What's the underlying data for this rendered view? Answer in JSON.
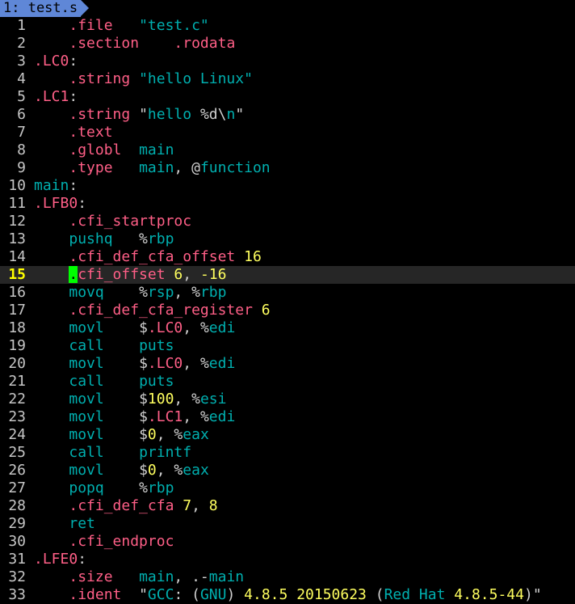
{
  "tab": {
    "label": "1: test.s",
    "background": "#5f87d7"
  },
  "cursor": {
    "line": 15,
    "highlight_color": "#00ff00"
  },
  "colors": {
    "directive": "#ff5f87",
    "instruction": "#00afaf",
    "label": "#00afaf",
    "number": "#ffff5f",
    "string": "#00afaf",
    "default": "#d0d0d0"
  },
  "lines": [
    {
      "n": "1",
      "tokens": [
        {
          "t": "    ",
          "c": "#d0d0d0"
        },
        {
          "t": ".file",
          "c": "#ff5f87"
        },
        {
          "t": "   ",
          "c": "#d0d0d0"
        },
        {
          "t": "\"test.c\"",
          "c": "#00afaf",
          "q": true
        }
      ]
    },
    {
      "n": "2",
      "tokens": [
        {
          "t": "    ",
          "c": "#d0d0d0"
        },
        {
          "t": ".section",
          "c": "#ff5f87"
        },
        {
          "t": "    ",
          "c": "#d0d0d0"
        },
        {
          "t": ".rodata",
          "c": "#ff5f87"
        }
      ]
    },
    {
      "n": "3",
      "tokens": [
        {
          "t": ".LC0",
          "c": "#ff5f87"
        },
        {
          "t": ":",
          "c": "#d0d0d0"
        }
      ]
    },
    {
      "n": "4",
      "tokens": [
        {
          "t": "    ",
          "c": "#d0d0d0"
        },
        {
          "t": ".string",
          "c": "#ff5f87"
        },
        {
          "t": " ",
          "c": "#d0d0d0"
        },
        {
          "t": "\"hello Linux\"",
          "c": "#00afaf",
          "q": true
        }
      ]
    },
    {
      "n": "5",
      "tokens": [
        {
          "t": ".LC1",
          "c": "#ff5f87"
        },
        {
          "t": ":",
          "c": "#d0d0d0"
        }
      ]
    },
    {
      "n": "6",
      "tokens": [
        {
          "t": "    ",
          "c": "#d0d0d0"
        },
        {
          "t": ".string",
          "c": "#ff5f87"
        },
        {
          "t": " ",
          "c": "#d0d0d0"
        },
        {
          "t": "\"",
          "c": "#d0d0d0"
        },
        {
          "t": "hello ",
          "c": "#00afaf"
        },
        {
          "t": "%d",
          "c": "#d0d0d0"
        },
        {
          "t": "\\",
          "c": "#d0d0d0"
        },
        {
          "t": "n",
          "c": "#00afaf"
        },
        {
          "t": "\"",
          "c": "#d0d0d0"
        }
      ]
    },
    {
      "n": "7",
      "tokens": [
        {
          "t": "    ",
          "c": "#d0d0d0"
        },
        {
          "t": ".text",
          "c": "#ff5f87"
        }
      ]
    },
    {
      "n": "8",
      "tokens": [
        {
          "t": "    ",
          "c": "#d0d0d0"
        },
        {
          "t": ".globl",
          "c": "#ff5f87"
        },
        {
          "t": "  ",
          "c": "#d0d0d0"
        },
        {
          "t": "main",
          "c": "#00afaf"
        }
      ]
    },
    {
      "n": "9",
      "tokens": [
        {
          "t": "    ",
          "c": "#d0d0d0"
        },
        {
          "t": ".type",
          "c": "#ff5f87"
        },
        {
          "t": "   ",
          "c": "#d0d0d0"
        },
        {
          "t": "main",
          "c": "#00afaf"
        },
        {
          "t": ", @",
          "c": "#d0d0d0"
        },
        {
          "t": "function",
          "c": "#00afaf"
        }
      ]
    },
    {
      "n": "10",
      "tokens": [
        {
          "t": "main",
          "c": "#00afaf"
        },
        {
          "t": ":",
          "c": "#d0d0d0"
        }
      ]
    },
    {
      "n": "11",
      "tokens": [
        {
          "t": ".LFB0",
          "c": "#ff5f87"
        },
        {
          "t": ":",
          "c": "#d0d0d0"
        }
      ]
    },
    {
      "n": "12",
      "tokens": [
        {
          "t": "    ",
          "c": "#d0d0d0"
        },
        {
          "t": ".cfi_startproc",
          "c": "#ff5f87"
        }
      ]
    },
    {
      "n": "13",
      "tokens": [
        {
          "t": "    ",
          "c": "#d0d0d0"
        },
        {
          "t": "pushq",
          "c": "#00afaf"
        },
        {
          "t": "   %",
          "c": "#d0d0d0"
        },
        {
          "t": "rbp",
          "c": "#00afaf"
        }
      ]
    },
    {
      "n": "14",
      "tokens": [
        {
          "t": "    ",
          "c": "#d0d0d0"
        },
        {
          "t": ".cfi_def_cfa_offset",
          "c": "#ff5f87"
        },
        {
          "t": " ",
          "c": "#d0d0d0"
        },
        {
          "t": "16",
          "c": "#ffff5f"
        }
      ]
    },
    {
      "n": "15",
      "tokens": [
        {
          "t": "    ",
          "c": "#d0d0d0"
        },
        {
          "t": ".",
          "c": "#000000",
          "cursor": true
        },
        {
          "t": "cfi_offset",
          "c": "#ff5f87"
        },
        {
          "t": " ",
          "c": "#d0d0d0"
        },
        {
          "t": "6",
          "c": "#ffff5f"
        },
        {
          "t": ", ",
          "c": "#d0d0d0"
        },
        {
          "t": "-16",
          "c": "#ffff5f"
        }
      ]
    },
    {
      "n": "16",
      "tokens": [
        {
          "t": "    ",
          "c": "#d0d0d0"
        },
        {
          "t": "movq",
          "c": "#00afaf"
        },
        {
          "t": "    %",
          "c": "#d0d0d0"
        },
        {
          "t": "rsp",
          "c": "#00afaf"
        },
        {
          "t": ", %",
          "c": "#d0d0d0"
        },
        {
          "t": "rbp",
          "c": "#00afaf"
        }
      ]
    },
    {
      "n": "17",
      "tokens": [
        {
          "t": "    ",
          "c": "#d0d0d0"
        },
        {
          "t": ".cfi_def_cfa_register",
          "c": "#ff5f87"
        },
        {
          "t": " ",
          "c": "#d0d0d0"
        },
        {
          "t": "6",
          "c": "#ffff5f"
        }
      ]
    },
    {
      "n": "18",
      "tokens": [
        {
          "t": "    ",
          "c": "#d0d0d0"
        },
        {
          "t": "movl",
          "c": "#00afaf"
        },
        {
          "t": "    $",
          "c": "#d0d0d0"
        },
        {
          "t": ".LC0",
          "c": "#ff5f87"
        },
        {
          "t": ", %",
          "c": "#d0d0d0"
        },
        {
          "t": "edi",
          "c": "#00afaf"
        }
      ]
    },
    {
      "n": "19",
      "tokens": [
        {
          "t": "    ",
          "c": "#d0d0d0"
        },
        {
          "t": "call",
          "c": "#00afaf"
        },
        {
          "t": "    ",
          "c": "#d0d0d0"
        },
        {
          "t": "puts",
          "c": "#00afaf"
        }
      ]
    },
    {
      "n": "20",
      "tokens": [
        {
          "t": "    ",
          "c": "#d0d0d0"
        },
        {
          "t": "movl",
          "c": "#00afaf"
        },
        {
          "t": "    $",
          "c": "#d0d0d0"
        },
        {
          "t": ".LC0",
          "c": "#ff5f87"
        },
        {
          "t": ", %",
          "c": "#d0d0d0"
        },
        {
          "t": "edi",
          "c": "#00afaf"
        }
      ]
    },
    {
      "n": "21",
      "tokens": [
        {
          "t": "    ",
          "c": "#d0d0d0"
        },
        {
          "t": "call",
          "c": "#00afaf"
        },
        {
          "t": "    ",
          "c": "#d0d0d0"
        },
        {
          "t": "puts",
          "c": "#00afaf"
        }
      ]
    },
    {
      "n": "22",
      "tokens": [
        {
          "t": "    ",
          "c": "#d0d0d0"
        },
        {
          "t": "movl",
          "c": "#00afaf"
        },
        {
          "t": "    $",
          "c": "#d0d0d0"
        },
        {
          "t": "100",
          "c": "#ffff5f"
        },
        {
          "t": ", %",
          "c": "#d0d0d0"
        },
        {
          "t": "esi",
          "c": "#00afaf"
        }
      ]
    },
    {
      "n": "23",
      "tokens": [
        {
          "t": "    ",
          "c": "#d0d0d0"
        },
        {
          "t": "movl",
          "c": "#00afaf"
        },
        {
          "t": "    $",
          "c": "#d0d0d0"
        },
        {
          "t": ".LC1",
          "c": "#ff5f87"
        },
        {
          "t": ", %",
          "c": "#d0d0d0"
        },
        {
          "t": "edi",
          "c": "#00afaf"
        }
      ]
    },
    {
      "n": "24",
      "tokens": [
        {
          "t": "    ",
          "c": "#d0d0d0"
        },
        {
          "t": "movl",
          "c": "#00afaf"
        },
        {
          "t": "    $",
          "c": "#d0d0d0"
        },
        {
          "t": "0",
          "c": "#ffff5f"
        },
        {
          "t": ", %",
          "c": "#d0d0d0"
        },
        {
          "t": "eax",
          "c": "#00afaf"
        }
      ]
    },
    {
      "n": "25",
      "tokens": [
        {
          "t": "    ",
          "c": "#d0d0d0"
        },
        {
          "t": "call",
          "c": "#00afaf"
        },
        {
          "t": "    ",
          "c": "#d0d0d0"
        },
        {
          "t": "printf",
          "c": "#00afaf"
        }
      ]
    },
    {
      "n": "26",
      "tokens": [
        {
          "t": "    ",
          "c": "#d0d0d0"
        },
        {
          "t": "movl",
          "c": "#00afaf"
        },
        {
          "t": "    $",
          "c": "#d0d0d0"
        },
        {
          "t": "0",
          "c": "#ffff5f"
        },
        {
          "t": ", %",
          "c": "#d0d0d0"
        },
        {
          "t": "eax",
          "c": "#00afaf"
        }
      ]
    },
    {
      "n": "27",
      "tokens": [
        {
          "t": "    ",
          "c": "#d0d0d0"
        },
        {
          "t": "popq",
          "c": "#00afaf"
        },
        {
          "t": "    %",
          "c": "#d0d0d0"
        },
        {
          "t": "rbp",
          "c": "#00afaf"
        }
      ]
    },
    {
      "n": "28",
      "tokens": [
        {
          "t": "    ",
          "c": "#d0d0d0"
        },
        {
          "t": ".cfi_def_cfa",
          "c": "#ff5f87"
        },
        {
          "t": " ",
          "c": "#d0d0d0"
        },
        {
          "t": "7",
          "c": "#ffff5f"
        },
        {
          "t": ", ",
          "c": "#d0d0d0"
        },
        {
          "t": "8",
          "c": "#ffff5f"
        }
      ]
    },
    {
      "n": "29",
      "tokens": [
        {
          "t": "    ",
          "c": "#d0d0d0"
        },
        {
          "t": "ret",
          "c": "#00afaf"
        }
      ]
    },
    {
      "n": "30",
      "tokens": [
        {
          "t": "    ",
          "c": "#d0d0d0"
        },
        {
          "t": ".cfi_endproc",
          "c": "#ff5f87"
        }
      ]
    },
    {
      "n": "31",
      "tokens": [
        {
          "t": ".LFE0",
          "c": "#ff5f87"
        },
        {
          "t": ":",
          "c": "#d0d0d0"
        }
      ]
    },
    {
      "n": "32",
      "tokens": [
        {
          "t": "    ",
          "c": "#d0d0d0"
        },
        {
          "t": ".size",
          "c": "#ff5f87"
        },
        {
          "t": "   ",
          "c": "#d0d0d0"
        },
        {
          "t": "main",
          "c": "#00afaf"
        },
        {
          "t": ", .-",
          "c": "#d0d0d0"
        },
        {
          "t": "main",
          "c": "#00afaf"
        }
      ]
    },
    {
      "n": "33",
      "tokens": [
        {
          "t": "    ",
          "c": "#d0d0d0"
        },
        {
          "t": ".ident",
          "c": "#ff5f87"
        },
        {
          "t": "  ",
          "c": "#d0d0d0"
        },
        {
          "t": "\"",
          "c": "#d0d0d0"
        },
        {
          "t": "GCC",
          "c": "#00afaf"
        },
        {
          "t": ": (",
          "c": "#d0d0d0"
        },
        {
          "t": "GNU",
          "c": "#00afaf"
        },
        {
          "t": ") ",
          "c": "#d0d0d0"
        },
        {
          "t": "4.8.5",
          "c": "#ffff5f"
        },
        {
          "t": " ",
          "c": "#d0d0d0"
        },
        {
          "t": "20150623",
          "c": "#ffff5f"
        },
        {
          "t": " (",
          "c": "#d0d0d0"
        },
        {
          "t": "Red Hat",
          "c": "#00afaf"
        },
        {
          "t": " ",
          "c": "#d0d0d0"
        },
        {
          "t": "4.8.5-44",
          "c": "#ffff5f"
        },
        {
          "t": ")\"",
          "c": "#d0d0d0"
        }
      ]
    }
  ]
}
